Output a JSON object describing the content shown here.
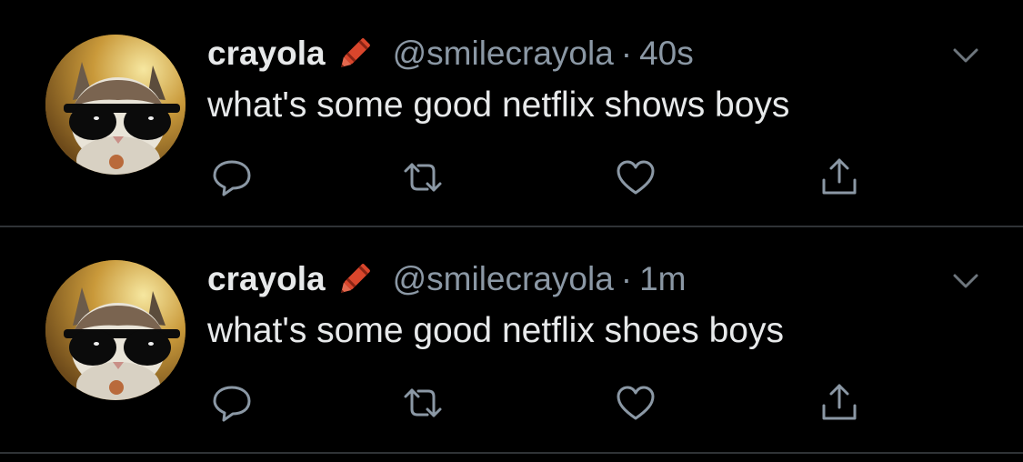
{
  "tweets": [
    {
      "display_name": "crayola",
      "name_emoji": "crayon-icon",
      "handle": "@smilecrayola",
      "separator": "·",
      "time": "40s",
      "text": "what's some good netflix shows boys",
      "actions": [
        "reply-icon",
        "retweet-icon",
        "like-icon",
        "share-icon"
      ]
    },
    {
      "display_name": "crayola",
      "name_emoji": "crayon-icon",
      "handle": "@smilecrayola",
      "separator": "·",
      "time": "1m",
      "text": "what's some good netflix shoes boys",
      "actions": [
        "reply-icon",
        "retweet-icon",
        "like-icon",
        "share-icon"
      ]
    }
  ],
  "colors": {
    "background": "#000000",
    "primary_text": "#e7e9ea",
    "secondary_text": "#8b98a5",
    "divider": "#2f3336",
    "crayon": "#d9462c"
  }
}
